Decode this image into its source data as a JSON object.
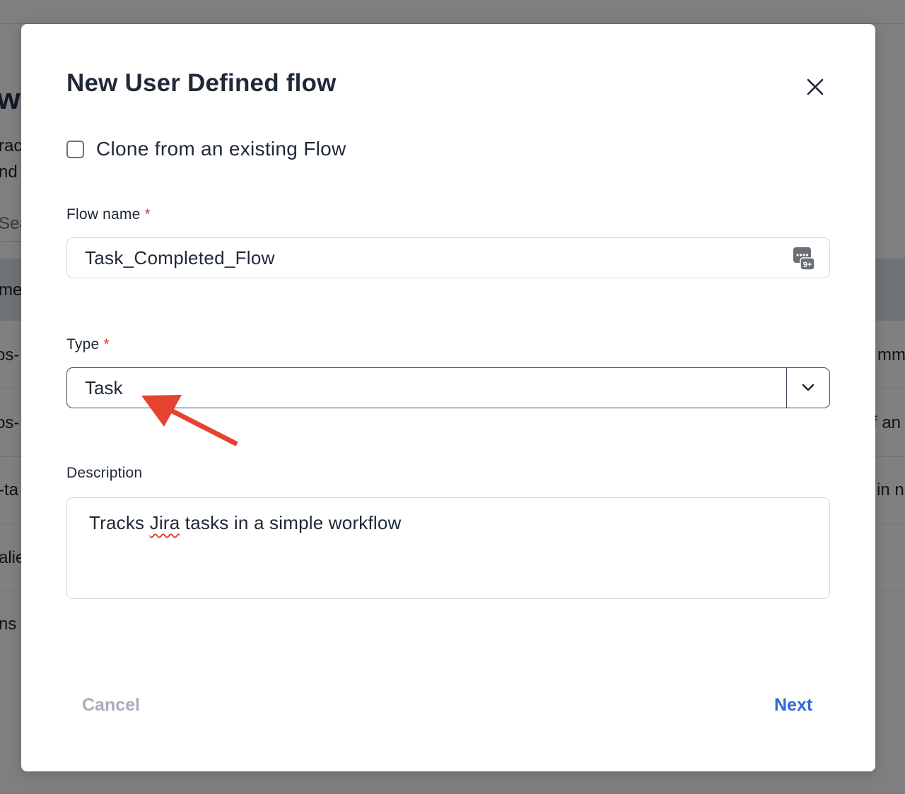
{
  "background": {
    "fragments": [
      "w",
      "rac",
      "nd",
      "Sea",
      "me",
      "os-",
      "os-",
      "-ta",
      "alie",
      "ns",
      "mm",
      "f an",
      "in n"
    ]
  },
  "modal": {
    "title": "New User Defined flow",
    "close_icon": "close-icon",
    "clone_checkbox": {
      "label": "Clone from an existing Flow",
      "checked": false
    },
    "flow_name": {
      "label": "Flow name",
      "required_mark": "*",
      "value": "Task_Completed_Flow",
      "icon": "password-manager-icon",
      "icon_badge": "9+"
    },
    "type": {
      "label": "Type",
      "required_mark": "*",
      "selected": "Task",
      "icon": "chevron-down-icon"
    },
    "description": {
      "label": "Description",
      "value_before": "Tracks ",
      "value_misspelled": "Jira",
      "value_after": " tasks in a simple workflow"
    },
    "footer": {
      "cancel_label": "Cancel",
      "next_label": "Next"
    }
  },
  "annotation": {
    "type": "arrow",
    "color": "#e5432f"
  },
  "colors": {
    "accent": "#2d6ad6",
    "required": "#d9342b",
    "muted": "#a6aebb",
    "text": "#1f2937"
  }
}
